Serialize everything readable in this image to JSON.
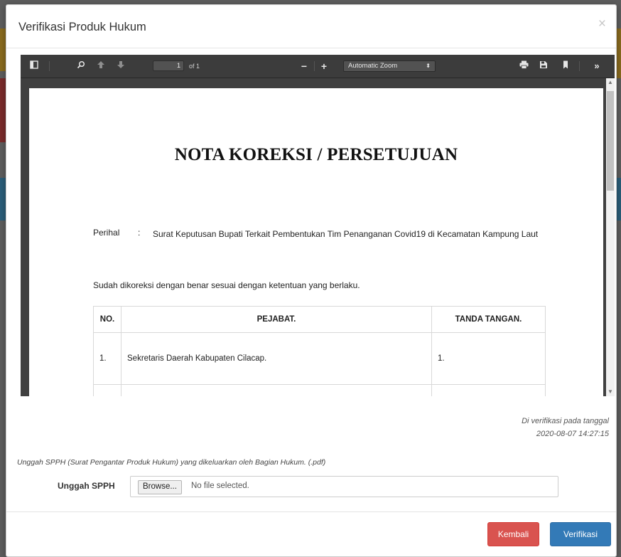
{
  "modal": {
    "title": "Verifikasi Produk Hukum",
    "close_glyph": "×"
  },
  "pdf_viewer": {
    "toolbar": {
      "sidebar_toggle_icon": "sidebar-toggle-icon",
      "find_icon": "search-icon",
      "prev_icon": "arrow-up-icon",
      "next_icon": "arrow-down-icon",
      "page_number": "1",
      "page_count_label": "of 1",
      "zoom_out": "−",
      "zoom_in": "+",
      "zoom_value": "Automatic Zoom",
      "print_icon": "print-icon",
      "download_icon": "download-icon",
      "bookmark_icon": "bookmark-icon",
      "tools_icon": "double-chevron-right-icon"
    },
    "document": {
      "title": "NOTA KOREKSI / PERSETUJUAN",
      "perihal_label": "Perihal",
      "perihal_colon": ":",
      "perihal_text": "Surat Keputusan Bupati Terkait Pembentukan Tim Penanganan Covid19 di Kecamatan Kampung Laut",
      "statement": "Sudah dikoreksi dengan benar sesuai dengan ketentuan yang berlaku.",
      "table": {
        "headers": [
          "NO.",
          "PEJABAT.",
          "TANDA TANGAN."
        ],
        "rows": [
          {
            "no": "1.",
            "pejabat": "Sekretaris Daerah Kabupaten Cilacap.",
            "tanda": "1."
          },
          {
            "no": "",
            "pejabat": "",
            "tanda": ""
          }
        ]
      }
    }
  },
  "verification": {
    "note_line1": "Di verifikasi pada tanggal",
    "note_line2": "2020-08-07 14:27:15"
  },
  "upload": {
    "hint": "Unggah SPPH (Surat Pengantar Produk Hukum) yang dikeluarkan oleh Bagian Hukum. (.pdf)",
    "label": "Unggah SPPH",
    "browse_label": "Browse...",
    "status": "No file selected."
  },
  "footer": {
    "back_label": "Kembali",
    "verify_label": "Verifikasi"
  },
  "colors": {
    "danger": "#d9534f",
    "primary": "#337ab7",
    "viewer_toolbar": "#3c3c3c"
  }
}
